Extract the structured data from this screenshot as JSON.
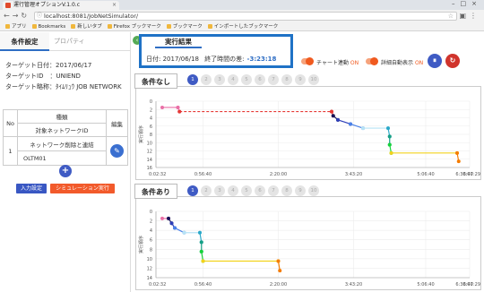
{
  "browser": {
    "tab_title": "運行管理オプションV.1.0.c",
    "url": "localhost:8081/JobNetSimulator/",
    "bookmarks": [
      "アプリ",
      "Bookmarks",
      "新しいタブ",
      "Firefox ブックマーク",
      "ブックマーク",
      "インポートしたブックマーク"
    ]
  },
  "left": {
    "tab_active": "条件設定",
    "tab_inactive": "プロパティ",
    "target_date": "ターゲット日付：2017/06/17",
    "target_id": "ターゲットID　：UNIEND",
    "target_name": "ターゲット略称：ﾀｲﾑﾘｭｳ JOB NETWORK",
    "table": {
      "col_no": "No",
      "col_type": "種類",
      "col_target": "対象ネットワークID",
      "col_edit": "編集",
      "row_no": "1",
      "row_type": "ネットワーク削除と連結",
      "row_target": "OLTM01"
    },
    "add_label": "+",
    "input_btn": "入力設定",
    "sim_btn": "シミュレーション実行"
  },
  "right": {
    "tab": "実行結果",
    "date_label": "日付:",
    "date_value": "2017/06/18",
    "diff_label": "終了時間の差:",
    "diff_value": "-3:23:18",
    "toggle1_label": "チャート連動",
    "toggle1_state": "ON",
    "toggle2_label": "詳細自動表示",
    "toggle2_state": "ON",
    "pause_label": "⏸",
    "refresh_label": "↻",
    "section1_title": "条件なし",
    "section2_title": "条件あり",
    "pages": [
      "1",
      "2",
      "3",
      "4",
      "5",
      "6",
      "7",
      "8",
      "9",
      "10"
    ],
    "ylabel": "実行順序",
    "colors": {
      "accent": "#3f5bc4",
      "orange": "#f05a1f",
      "highlight": "#1f72c6"
    }
  },
  "chart_data": [
    {
      "type": "line",
      "title": "条件なし",
      "xlabel": "",
      "ylabel": "実行順序",
      "x_ticks": [
        "0:02:32",
        "0:56:40",
        "2:20:00",
        "3:43:20",
        "5:06:40",
        "6:30:00",
        "6:47:29"
      ],
      "y_ticks": [
        0,
        2,
        4,
        6,
        8,
        10,
        12,
        14,
        16
      ],
      "ylim": [
        16,
        0
      ],
      "segments": [
        {
          "color": "#e96fa6",
          "points": [
            [
              0.02,
              1.5
            ],
            [
              0.07,
              1.5
            ]
          ]
        },
        {
          "color": "#e96fa6",
          "points": [
            [
              0.07,
              1.5
            ],
            [
              0.075,
              2.5
            ]
          ]
        },
        {
          "color": "#e53935",
          "dash": true,
          "points": [
            [
              0.075,
              2.5
            ],
            [
              0.56,
              2.5
            ]
          ]
        },
        {
          "color": "#e53935",
          "points": [
            [
              0.56,
              2.5
            ],
            [
              0.565,
              3.5
            ]
          ]
        },
        {
          "color": "#14145a",
          "points": [
            [
              0.565,
              3.5
            ],
            [
              0.58,
              4.5
            ]
          ]
        },
        {
          "color": "#2e3fb8",
          "points": [
            [
              0.58,
              4.5
            ],
            [
              0.62,
              5.5
            ]
          ]
        },
        {
          "color": "#4b82e8",
          "points": [
            [
              0.62,
              5.5
            ],
            [
              0.66,
              6.5
            ]
          ]
        },
        {
          "color": "#b7e3f5",
          "points": [
            [
              0.66,
              6.5
            ],
            [
              0.74,
              6.5
            ]
          ]
        },
        {
          "color": "#2aa8c8",
          "points": [
            [
              0.74,
              6.5
            ],
            [
              0.745,
              8.5
            ]
          ]
        },
        {
          "color": "#16a085",
          "points": [
            [
              0.745,
              8.5
            ],
            [
              0.745,
              10.5
            ]
          ]
        },
        {
          "color": "#17d43a",
          "points": [
            [
              0.745,
              10.5
            ],
            [
              0.75,
              12.5
            ]
          ]
        },
        {
          "color": "#f2d21b",
          "points": [
            [
              0.75,
              12.5
            ],
            [
              0.96,
              12.5
            ]
          ]
        },
        {
          "color": "#f57c00",
          "points": [
            [
              0.96,
              12.5
            ],
            [
              0.965,
              14.5
            ]
          ]
        }
      ]
    },
    {
      "type": "line",
      "title": "条件あり",
      "xlabel": "",
      "ylabel": "実行順序",
      "x_ticks": [
        "0:02:32",
        "0:56:40",
        "2:20:00",
        "3:43:20",
        "5:06:40",
        "6:30:00",
        "6:47:29"
      ],
      "y_ticks": [
        0,
        2,
        4,
        6,
        8,
        10,
        12,
        14
      ],
      "ylim": [
        14,
        0
      ],
      "segments": [
        {
          "color": "#e96fa6",
          "points": [
            [
              0.02,
              1.5
            ],
            [
              0.04,
              1.5
            ]
          ]
        },
        {
          "color": "#14145a",
          "points": [
            [
              0.04,
              1.5
            ],
            [
              0.05,
              2.5
            ]
          ]
        },
        {
          "color": "#2e3fb8",
          "points": [
            [
              0.05,
              2.5
            ],
            [
              0.06,
              3.5
            ]
          ]
        },
        {
          "color": "#4b82e8",
          "points": [
            [
              0.06,
              3.5
            ],
            [
              0.09,
              4.5
            ]
          ]
        },
        {
          "color": "#b7e3f5",
          "points": [
            [
              0.09,
              4.5
            ],
            [
              0.14,
              4.5
            ]
          ]
        },
        {
          "color": "#2aa8c8",
          "points": [
            [
              0.14,
              4.5
            ],
            [
              0.145,
              6.5
            ]
          ]
        },
        {
          "color": "#16a085",
          "points": [
            [
              0.145,
              6.5
            ],
            [
              0.145,
              8.5
            ]
          ]
        },
        {
          "color": "#17d43a",
          "points": [
            [
              0.145,
              8.5
            ],
            [
              0.15,
              10.5
            ]
          ]
        },
        {
          "color": "#f2d21b",
          "points": [
            [
              0.15,
              10.5
            ],
            [
              0.39,
              10.5
            ]
          ]
        },
        {
          "color": "#f57c00",
          "points": [
            [
              0.39,
              10.5
            ],
            [
              0.395,
              12.5
            ]
          ]
        }
      ]
    }
  ]
}
